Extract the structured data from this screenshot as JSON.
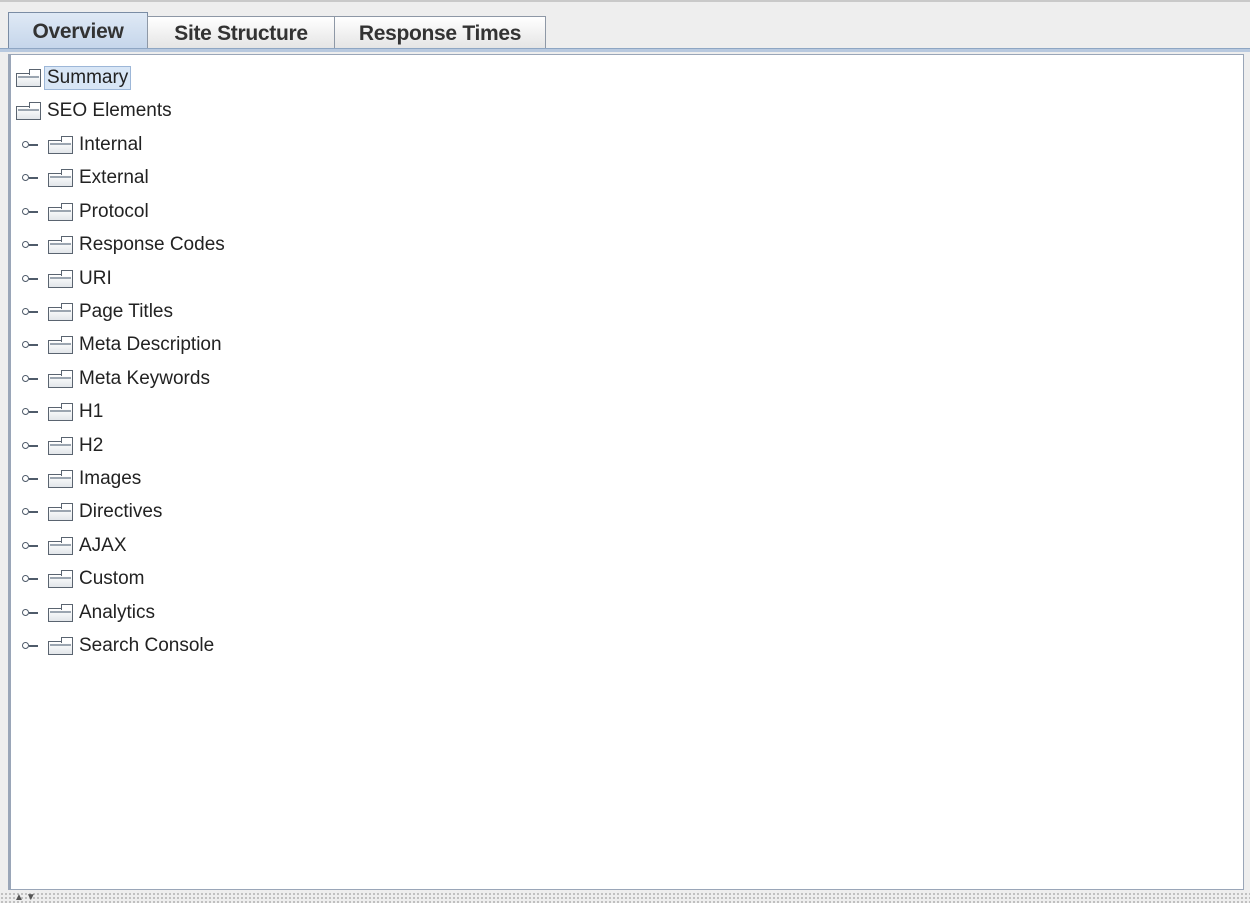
{
  "tabs": [
    {
      "label": "Overview",
      "active": true
    },
    {
      "label": "Site Structure",
      "active": false
    },
    {
      "label": "Response Times",
      "active": false
    }
  ],
  "tree": {
    "root_items": [
      {
        "label": "Summary",
        "icon": "folder-icon",
        "selected": true
      },
      {
        "label": "SEO Elements",
        "icon": "folder-icon",
        "selected": false
      }
    ],
    "children": [
      {
        "label": "Internal",
        "icon": "folder-icon"
      },
      {
        "label": "External",
        "icon": "folder-icon"
      },
      {
        "label": "Protocol",
        "icon": "folder-icon"
      },
      {
        "label": "Response Codes",
        "icon": "folder-icon"
      },
      {
        "label": "URI",
        "icon": "folder-icon"
      },
      {
        "label": "Page Titles",
        "icon": "folder-icon"
      },
      {
        "label": "Meta Description",
        "icon": "folder-icon"
      },
      {
        "label": "Meta Keywords",
        "icon": "folder-icon"
      },
      {
        "label": "H1",
        "icon": "folder-icon"
      },
      {
        "label": "H2",
        "icon": "folder-icon"
      },
      {
        "label": "Images",
        "icon": "folder-icon"
      },
      {
        "label": "Directives",
        "icon": "folder-icon"
      },
      {
        "label": "AJAX",
        "icon": "folder-icon"
      },
      {
        "label": "Custom",
        "icon": "folder-icon"
      },
      {
        "label": "Analytics",
        "icon": "folder-icon"
      },
      {
        "label": "Search Console",
        "icon": "folder-icon"
      }
    ]
  },
  "splitter": {
    "up_icon": "arrow-up-icon",
    "down_icon": "arrow-down-icon"
  },
  "colors": {
    "selection": "#d8e6f6",
    "tab_active": "#c4d5ea",
    "panel_border": "#9aa6b8"
  }
}
